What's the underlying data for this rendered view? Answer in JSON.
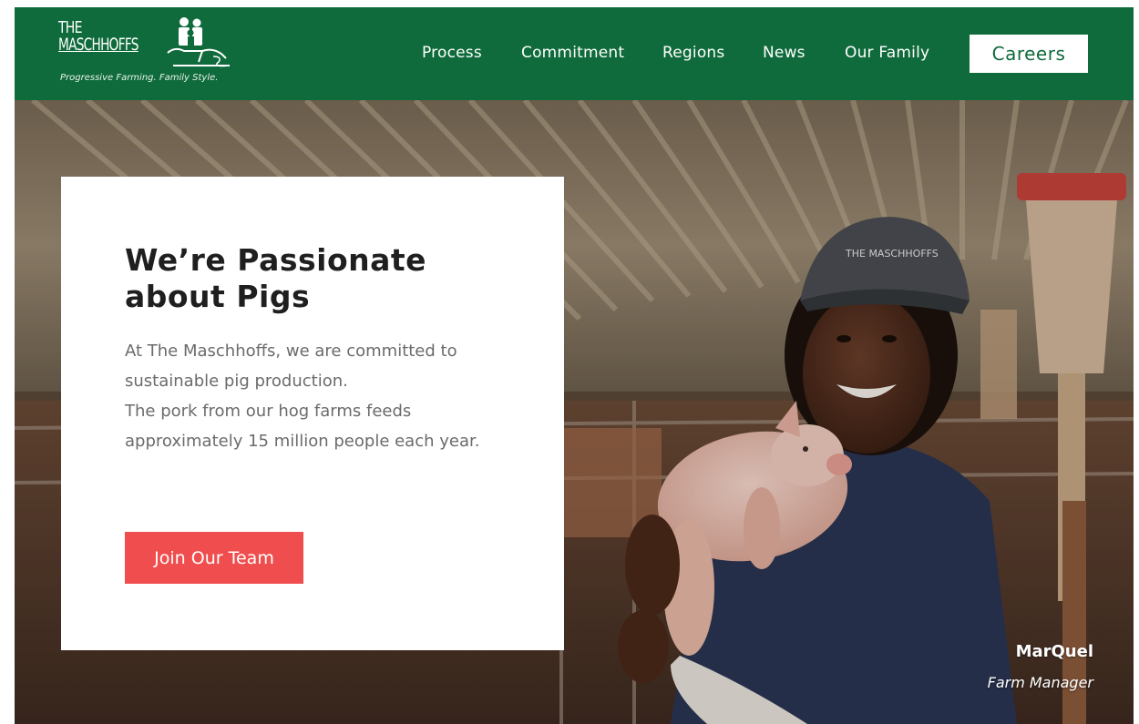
{
  "brand": {
    "logo_line1": "THE",
    "logo_line2": "MASCHHOFFS",
    "tagline": "Progressive Farming. Family Style.",
    "header_color": "#0f6b3b",
    "accent_color": "#f04e4e"
  },
  "nav": {
    "items": [
      {
        "label": "Process"
      },
      {
        "label": "Commitment"
      },
      {
        "label": "Regions"
      },
      {
        "label": "News"
      },
      {
        "label": "Our Family"
      }
    ],
    "careers_label": "Careers"
  },
  "hero": {
    "title": "We’re Passionate about Pigs",
    "body_line1": "At The Maschhoffs, we are committed to sustainable pig production.",
    "body_line2": "The pork from our hog farms feeds approximately 15 million people each year.",
    "cta_label": "Join Our Team",
    "caption_name": "MarQuel",
    "caption_role": "Farm Manager",
    "photo_subject": "farm-manager-holding-piglet-photo",
    "cap_logo_text": "THE MASCHHOFFS"
  }
}
